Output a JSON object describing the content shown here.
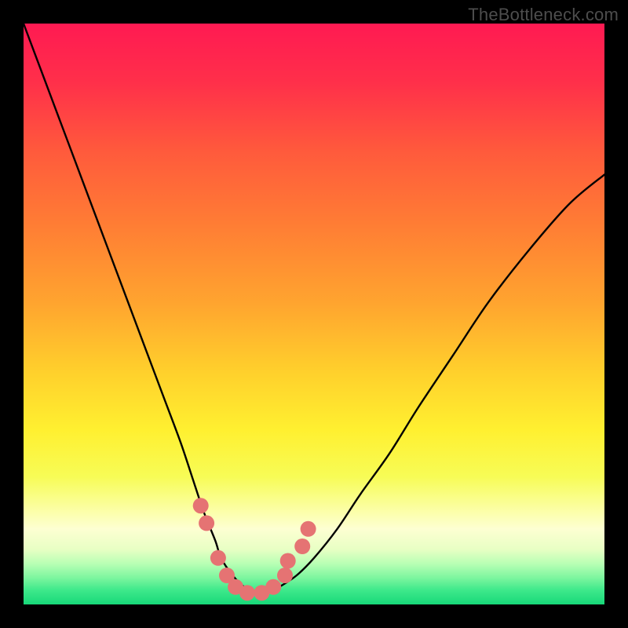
{
  "watermark": "TheBottleneck.com",
  "chart_data": {
    "type": "line",
    "title": "",
    "xlabel": "",
    "ylabel": "",
    "xlim": [
      0,
      100
    ],
    "ylim": [
      0,
      100
    ],
    "grid": false,
    "series": [
      {
        "name": "bottleneck-curve",
        "x": [
          0,
          3,
          6,
          9,
          12,
          15,
          18,
          21,
          24,
          27,
          29,
          31,
          33,
          34,
          36,
          38,
          40,
          42,
          44,
          47,
          50,
          54,
          58,
          63,
          68,
          74,
          80,
          87,
          94,
          100
        ],
        "values": [
          100,
          92,
          84,
          76,
          68,
          60,
          52,
          44,
          36,
          28,
          22,
          16,
          11,
          8,
          5,
          3,
          2,
          2,
          3,
          5,
          8,
          13,
          19,
          26,
          34,
          43,
          52,
          61,
          69,
          74
        ]
      }
    ],
    "markers": {
      "name": "highlight-dots",
      "color": "#e57373",
      "points": [
        {
          "x": 30.5,
          "y": 17
        },
        {
          "x": 31.5,
          "y": 14
        },
        {
          "x": 33.5,
          "y": 8
        },
        {
          "x": 35.0,
          "y": 5
        },
        {
          "x": 36.5,
          "y": 3
        },
        {
          "x": 38.5,
          "y": 2
        },
        {
          "x": 41.0,
          "y": 2
        },
        {
          "x": 43.0,
          "y": 3
        },
        {
          "x": 45.0,
          "y": 5
        },
        {
          "x": 45.5,
          "y": 7.5
        },
        {
          "x": 48.0,
          "y": 10
        },
        {
          "x": 49.0,
          "y": 13
        }
      ]
    },
    "gradient_stops": [
      {
        "pos": 0.0,
        "color": "#ff1a52"
      },
      {
        "pos": 0.1,
        "color": "#ff2f4a"
      },
      {
        "pos": 0.22,
        "color": "#ff5a3c"
      },
      {
        "pos": 0.35,
        "color": "#ff7e34"
      },
      {
        "pos": 0.48,
        "color": "#ffa42f"
      },
      {
        "pos": 0.6,
        "color": "#ffd02c"
      },
      {
        "pos": 0.7,
        "color": "#fff030"
      },
      {
        "pos": 0.78,
        "color": "#f7fc56"
      },
      {
        "pos": 0.845,
        "color": "#fcffb0"
      },
      {
        "pos": 0.87,
        "color": "#fdffd2"
      },
      {
        "pos": 0.905,
        "color": "#e8ffc4"
      },
      {
        "pos": 0.93,
        "color": "#b8ffb4"
      },
      {
        "pos": 0.955,
        "color": "#7af59e"
      },
      {
        "pos": 0.975,
        "color": "#3fe98b"
      },
      {
        "pos": 1.0,
        "color": "#17d879"
      }
    ]
  }
}
